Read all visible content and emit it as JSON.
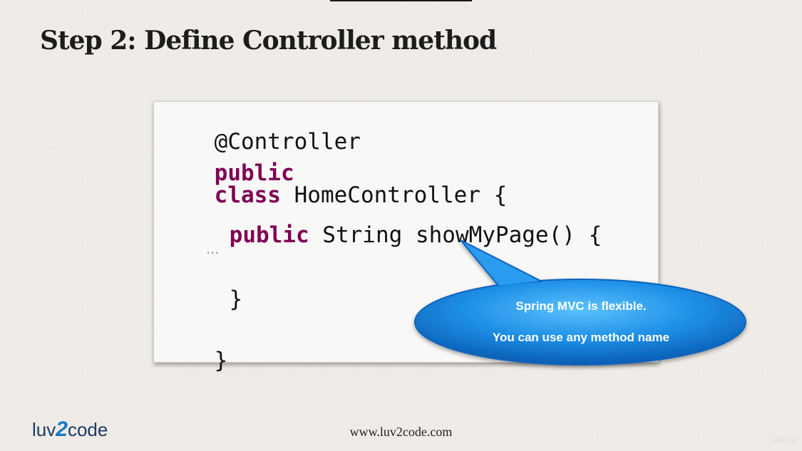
{
  "slide": {
    "title": "Step 2: Define Controller method"
  },
  "code": {
    "line1": "@Controller",
    "line2_kw1": "public",
    "line2_kw2": "class",
    "line2_rest": " HomeController {",
    "line3_kw": "public",
    "line3_rest": " String showMyPage() {",
    "ellipsis": "...",
    "line4": "}",
    "line5": "}"
  },
  "callout": {
    "line1": "Spring MVC is flexible.",
    "line2": "You can use any method name",
    "color": "#1e8fe6"
  },
  "footer": {
    "logo_prefix": "luv",
    "logo_number": "2",
    "logo_suffix": "code",
    "url": "www.luv2code.com",
    "watermark": "Udemy"
  },
  "colors": {
    "background": "#efebe6",
    "keyword": "#7f0055",
    "code_text": "#111111"
  }
}
